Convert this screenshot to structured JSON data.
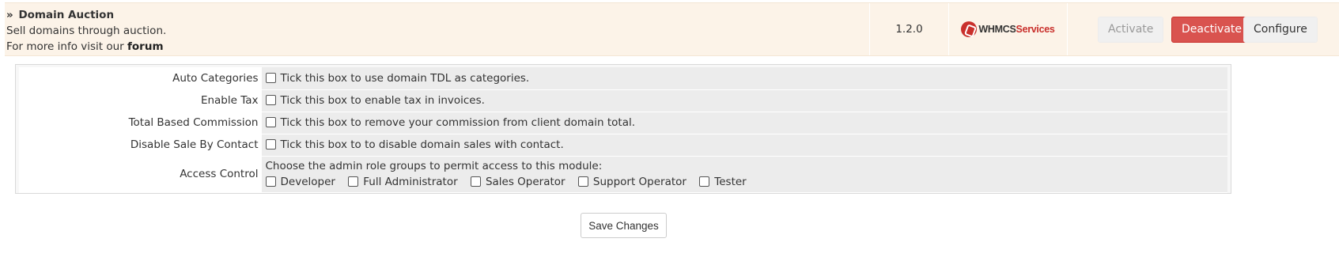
{
  "module": {
    "title_prefix": "»",
    "title": "Domain Auction",
    "description": "Sell domains through auction.",
    "more_info_prefix": "For more info visit our",
    "forum_link": "forum",
    "version": "1.2.0",
    "logo_text_1": "WHMCS",
    "logo_text_2": "Services",
    "buttons": {
      "activate": "Activate",
      "deactivate": "Deactivate",
      "configure": "Configure"
    }
  },
  "settings": [
    {
      "label": "Auto Categories",
      "description": "Tick this box to use domain TDL as categories."
    },
    {
      "label": "Enable Tax",
      "description": "Tick this box to enable tax in invoices."
    },
    {
      "label": "Total Based Commission",
      "description": "Tick this box to remove your commission from client domain total."
    },
    {
      "label": "Disable Sale By Contact",
      "description": "Tick this box to to disable domain sales with contact."
    }
  ],
  "access_control": {
    "label": "Access Control",
    "description": "Choose the admin role groups to permit access to this module:",
    "roles": [
      "Developer",
      "Full Administrator",
      "Sales Operator",
      "Support Operator",
      "Tester"
    ]
  },
  "save_label": "Save Changes",
  "colors": {
    "row_highlight": "#fcf3e8",
    "deactivate_button": "#d9534f",
    "brand_red": "#c9302c"
  }
}
